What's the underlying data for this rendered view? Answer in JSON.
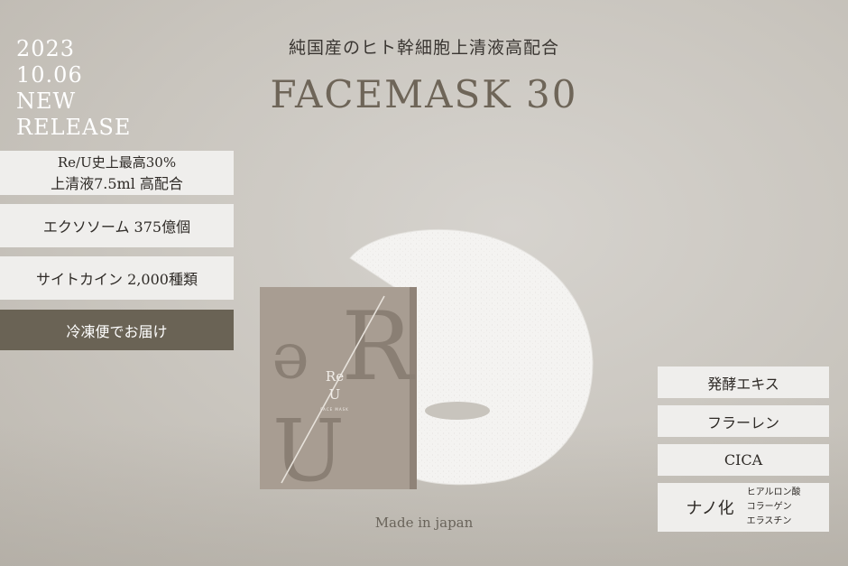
{
  "release": {
    "year": "2023",
    "date": "10.06",
    "new": "NEW",
    "release": "RELEASE"
  },
  "header": {
    "subtitle": "純国産のヒト幹細胞上清液高配合",
    "title": "FACEMASK 30"
  },
  "left_features": [
    {
      "line1": "Re/U史上最高30%",
      "line2": "上清液7.5ml 高配合"
    },
    {
      "line1": "エクソソーム 375億個"
    },
    {
      "line1": "サイトカイン 2,000種類"
    },
    {
      "line1": "冷凍便でお届け"
    }
  ],
  "right_features": [
    {
      "label": "発酵エキス"
    },
    {
      "label": "フラーレン"
    },
    {
      "label": "CICA"
    },
    {
      "label": "ナノ化",
      "items": [
        "ヒアルロン酸",
        "コラーゲン",
        "エラスチン"
      ]
    }
  ],
  "package": {
    "brand_top": "Re",
    "brand_bottom": "U",
    "sub": "FACE MASK"
  },
  "footer": {
    "made": "Made in japan"
  },
  "colors": {
    "background": "#cbc7c0",
    "box_light": "#efeeec",
    "box_dark": "#6a6355",
    "title": "#6e6558",
    "package": "#a89d92"
  }
}
